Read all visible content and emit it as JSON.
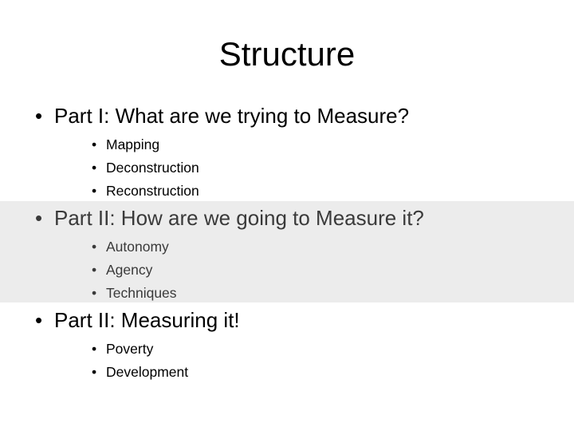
{
  "slide": {
    "title": "Structure",
    "background_color": "#ffffff",
    "highlight_band_color": "#ececec",
    "text_color": "#000000",
    "dim_text_color": "#3a3a3a",
    "bullet_glyph": "•",
    "sections": [
      {
        "heading": "Part I: What are we trying to Measure?",
        "highlighted": false,
        "sub_items": [
          "Mapping",
          "Deconstruction",
          "Reconstruction"
        ]
      },
      {
        "heading": "Part II: How are we going to Measure it?",
        "highlighted": true,
        "sub_items": [
          "Autonomy",
          "Agency",
          "Techniques"
        ]
      },
      {
        "heading": "Part II: Measuring it!",
        "highlighted": false,
        "sub_items": [
          "Poverty",
          "Development"
        ]
      }
    ]
  }
}
